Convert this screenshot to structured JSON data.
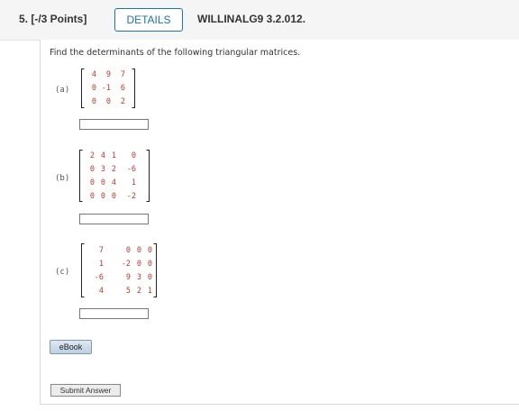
{
  "header": {
    "question_number": "5. [-/3 Points]",
    "details_label": "DETAILS",
    "problem_code": "WILLINALG9 3.2.012."
  },
  "prompt": "Find the determinants of the following triangular matrices.",
  "parts": [
    {
      "label": "(a)",
      "rows": [
        [
          "4",
          "9",
          "7"
        ],
        [
          "0",
          "-1",
          "6"
        ],
        [
          "0",
          "0",
          "2"
        ]
      ],
      "answer_value": ""
    },
    {
      "label": "(b)",
      "rows": [
        [
          "2",
          "4",
          "1",
          "0"
        ],
        [
          "0",
          "3",
          "2",
          "-6"
        ],
        [
          "0",
          "0",
          "4",
          "1"
        ],
        [
          "0",
          "0",
          "0",
          "-2"
        ]
      ],
      "answer_value": ""
    },
    {
      "label": "(c)",
      "rows": [
        [
          "7",
          "0",
          "0",
          "0"
        ],
        [
          "1",
          "-2",
          "0",
          "0"
        ],
        [
          "-6",
          "9",
          "3",
          "0"
        ],
        [
          "4",
          "5",
          "2",
          "1"
        ]
      ],
      "answer_value": ""
    }
  ],
  "ebook_label": "eBook",
  "submit_label": "Submit Answer"
}
